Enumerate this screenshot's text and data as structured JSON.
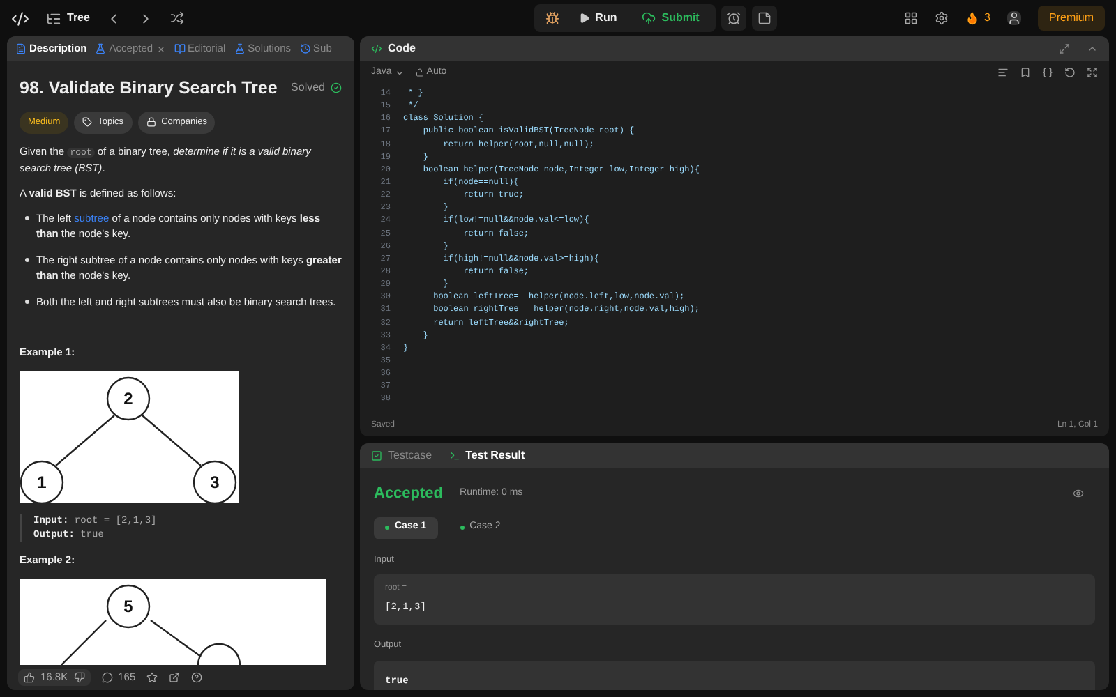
{
  "topbar": {
    "title": "Tree",
    "run": "Run",
    "submit": "Submit",
    "streak": "3",
    "premium": "Premium"
  },
  "left_tabs": [
    {
      "label": "Description",
      "selected": true,
      "closable": false
    },
    {
      "label": "Accepted",
      "selected": false,
      "closable": true
    },
    {
      "label": "Editorial",
      "selected": false,
      "closable": false
    },
    {
      "label": "Solutions",
      "selected": false,
      "closable": false
    },
    {
      "label": "Sub",
      "selected": false,
      "closable": false
    }
  ],
  "problem": {
    "title": "98. Validate Binary Search Tree",
    "status": "Solved",
    "difficulty": "Medium",
    "tags": [
      "Topics",
      "Companies"
    ],
    "intro": "Given the ",
    "intro_code": "root",
    "intro_rest": " of a binary tree, *determine if it is a valid binary search tree (BST)*.",
    "definition": "A **valid BST** is defined as follows:",
    "bullets": [
      {
        "before": "The left ",
        "link": "subtree",
        "after": " of a node contains only nodes with keys **less than** the node's key."
      },
      {
        "before": "The right subtree of a node contains only nodes with keys **greater than** the node's key."
      },
      {
        "before": "Both the left and right subtrees must also be binary search trees."
      }
    ],
    "examples": [
      {
        "heading": "Example 1:",
        "nodes": [
          "2",
          "1",
          "3"
        ],
        "input_label": "Input:",
        "input": "root = [2,1,3]",
        "output_label": "Output:",
        "output": "true"
      },
      {
        "heading": "Example 2:",
        "nodes": [
          "5"
        ]
      }
    ]
  },
  "footer": {
    "likes": "16.8K",
    "comments": "165"
  },
  "code": {
    "title": "Code",
    "language": "Java",
    "mode": "Auto",
    "lines": [
      {
        "number": "14",
        "text": " * }"
      },
      {
        "number": "15",
        "text": " */"
      },
      {
        "number": "16",
        "text": "class Solution {"
      },
      {
        "number": "17",
        "text": "    public boolean isValidBST(TreeNode root) {"
      },
      {
        "number": "18",
        "text": "        return helper(root,null,null);"
      },
      {
        "number": "19",
        "text": "    }"
      },
      {
        "number": "20",
        "text": "    boolean helper(TreeNode node,Integer low,Integer high){"
      },
      {
        "number": "21",
        "text": "        if(node==null){"
      },
      {
        "number": "22",
        "text": "            return true;"
      },
      {
        "number": "23",
        "text": "        }"
      },
      {
        "number": "24",
        "text": "        if(low!=null&&node.val<=low){"
      },
      {
        "number": "25",
        "text": "            return false;"
      },
      {
        "number": "26",
        "text": "        }"
      },
      {
        "number": "27",
        "text": "        if(high!=null&&node.val>=high){"
      },
      {
        "number": "28",
        "text": "            return false;"
      },
      {
        "number": "29",
        "text": "        }"
      },
      {
        "number": "30",
        "text": "      boolean leftTree=  helper(node.left,low,node.val);"
      },
      {
        "number": "31",
        "text": "      boolean rightTree=  helper(node.right,node.val,high);"
      },
      {
        "number": "32",
        "text": "      return leftTree&&rightTree;"
      },
      {
        "number": "33",
        "text": "    }"
      },
      {
        "number": "34",
        "text": "}"
      },
      {
        "number": "35"
      },
      {
        "number": "36"
      },
      {
        "number": "37"
      },
      {
        "number": "38"
      }
    ],
    "saved": "Saved",
    "cursor": "Ln 1, Col 1"
  },
  "result_tabs": [
    {
      "label": "Testcase",
      "selected": false
    },
    {
      "label": "Test Result",
      "selected": true
    }
  ],
  "result": {
    "verdict": "Accepted",
    "runtime": "Runtime: 0 ms",
    "cases": [
      {
        "label": "Case 1",
        "selected": true
      },
      {
        "label": "Case 2",
        "selected": false
      }
    ],
    "input_label": "Input",
    "input_name": "root =",
    "input_value": "[2,1,3]",
    "output_label": "Output",
    "output_value": "true"
  }
}
